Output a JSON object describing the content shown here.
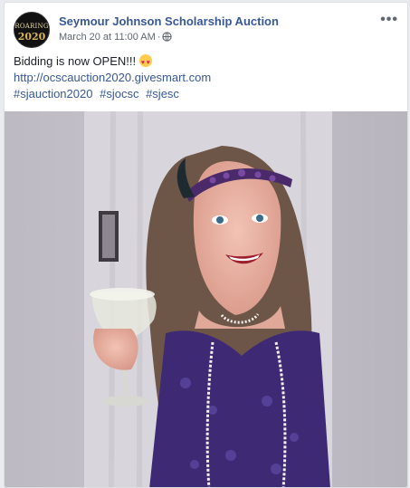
{
  "post": {
    "page_name": "Seymour Johnson Scholarship Auction",
    "avatar_top": "ROARING",
    "avatar_year": "2020",
    "timestamp": "March 20 at 11:00 AM",
    "audience_icon": "globe-icon",
    "message": "Bidding is now OPEN!!!",
    "emoji": "heart-eyes-emoji",
    "link": "http://ocscauction2020.givesmart.com",
    "hashtags": [
      "#sjauction2020",
      "#sjocsc",
      "#sjesc"
    ],
    "more_icon": "more-options-icon"
  },
  "colors": {
    "link": "#385898",
    "meta": "#606770",
    "background": "#e9ebee"
  }
}
